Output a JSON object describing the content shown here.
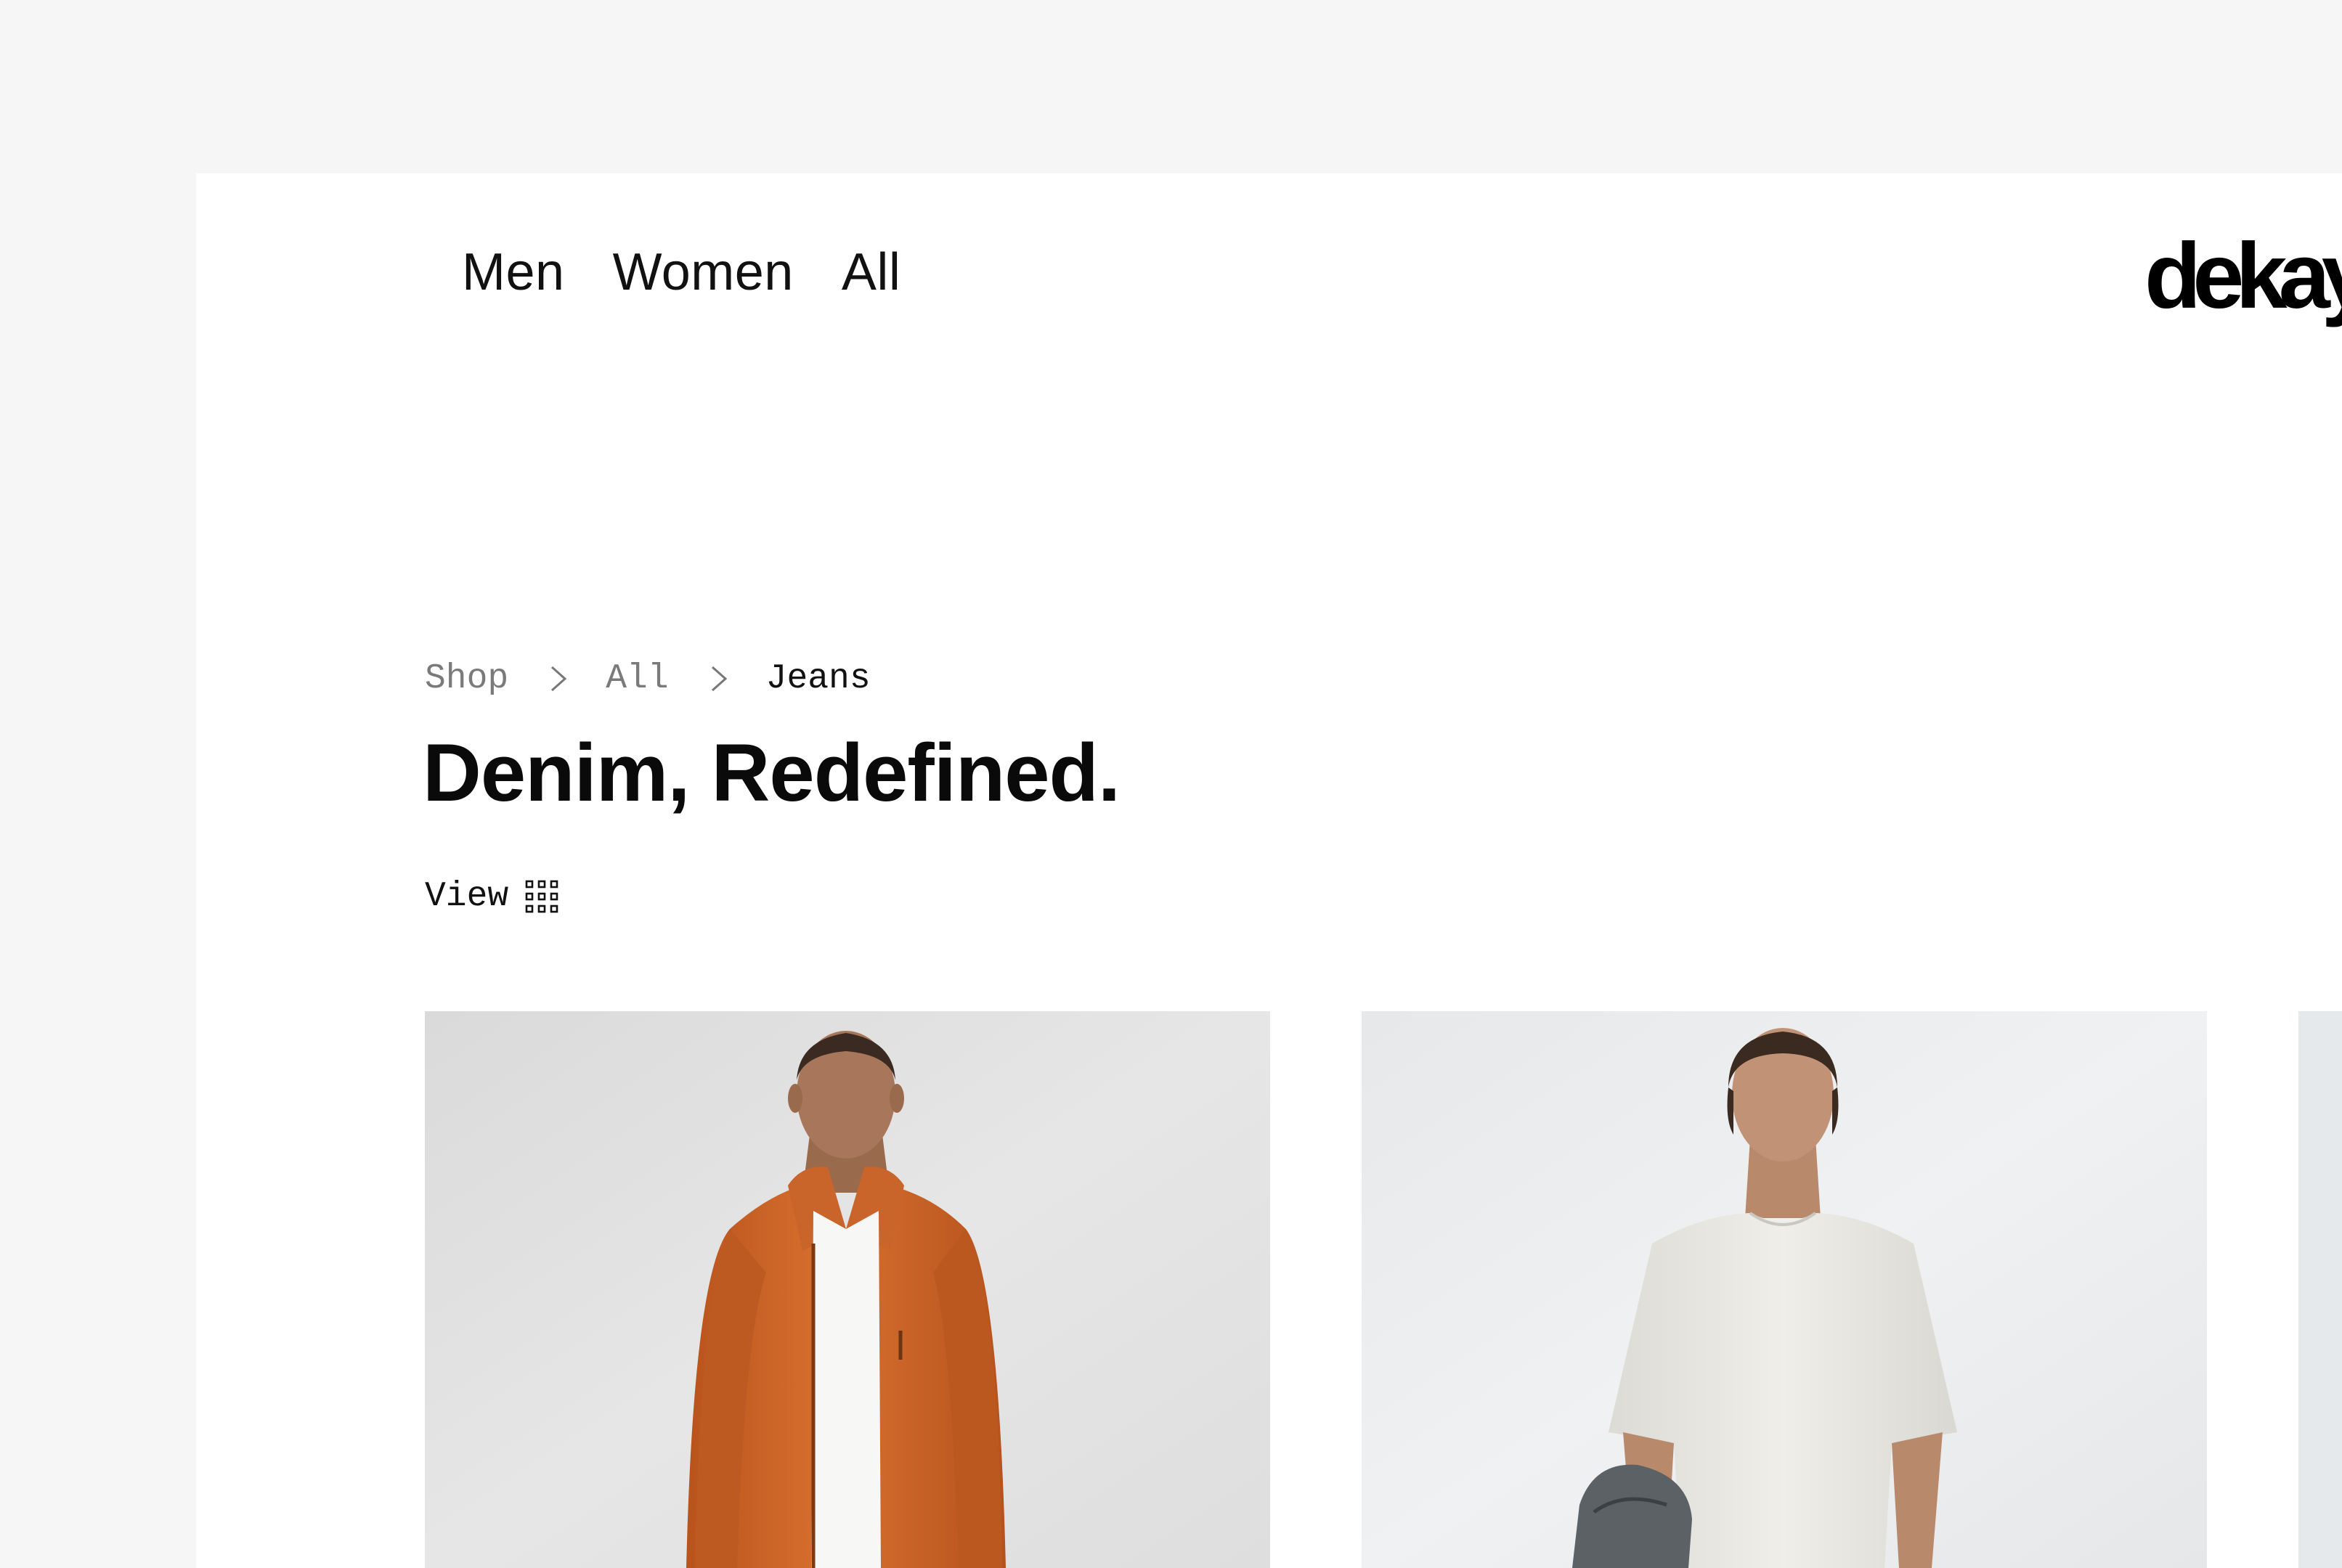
{
  "nav": {
    "items": [
      {
        "label": "Men"
      },
      {
        "label": "Women"
      },
      {
        "label": "All"
      }
    ]
  },
  "brand": {
    "logo_text": "dekay"
  },
  "breadcrumb": {
    "items": [
      "Shop",
      "All",
      "Jeans"
    ],
    "separator_icon": "chevron-right-icon"
  },
  "page": {
    "title": "Denim, Redefined."
  },
  "view_toggle": {
    "label": "View",
    "icon": "grid-icon"
  },
  "products": [
    {
      "description": "man-in-orange-jacket-photo",
      "jacket_color": "#d4682a",
      "background": "#e4e4e4"
    },
    {
      "description": "man-in-white-tshirt-photo",
      "shirt_color": "#ecebe6",
      "background": "#eceeef"
    },
    {
      "description": "partial-product-photo",
      "background": "#e8ebee"
    }
  ],
  "colors": {
    "page_background": "#f6f6f6",
    "card_background": "#ffffff",
    "text": "#0a0a0a",
    "muted_text": "#7a7a7a"
  }
}
